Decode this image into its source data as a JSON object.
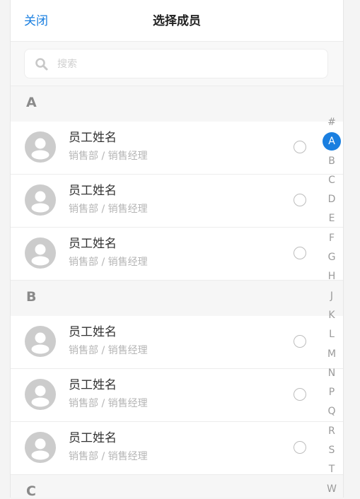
{
  "header": {
    "close_label": "关闭",
    "title": "选择成员"
  },
  "search": {
    "placeholder": "搜索",
    "icon": "search-icon"
  },
  "groups": [
    {
      "letter": "A",
      "members": [
        {
          "name": "员工姓名",
          "subtitle": "销售部 / 销售经理",
          "selected": false
        },
        {
          "name": "员工姓名",
          "subtitle": "销售部 / 销售经理",
          "selected": false
        },
        {
          "name": "员工姓名",
          "subtitle": "销售部 / 销售经理",
          "selected": false
        }
      ]
    },
    {
      "letter": "B",
      "members": [
        {
          "name": "员工姓名",
          "subtitle": "销售部 / 销售经理",
          "selected": false
        },
        {
          "name": "员工姓名",
          "subtitle": "销售部 / 销售经理",
          "selected": false
        },
        {
          "name": "员工姓名",
          "subtitle": "销售部 / 销售经理",
          "selected": false
        }
      ]
    },
    {
      "letter": "C",
      "members": []
    }
  ],
  "index_letters": [
    "#",
    "A",
    "B",
    "C",
    "D",
    "E",
    "F",
    "G",
    "H",
    "J",
    "K",
    "L",
    "M",
    "N",
    "P",
    "Q",
    "R",
    "S",
    "T",
    "W"
  ],
  "index_active": "A",
  "colors": {
    "accent": "#1a7fe0",
    "avatar": "#cccccc"
  }
}
